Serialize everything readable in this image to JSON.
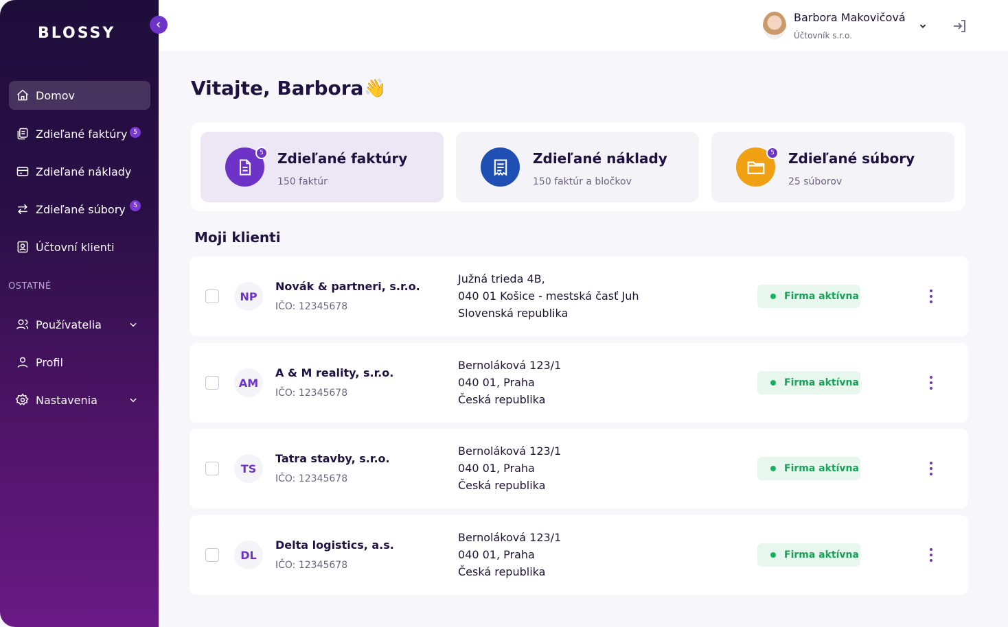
{
  "app": {
    "logo": "BLOSSY"
  },
  "sidebar": {
    "items": [
      {
        "label": "Domov",
        "icon": "home-icon",
        "active": true
      },
      {
        "label": "Zdieľané faktúry",
        "icon": "documents-icon",
        "badge": "5"
      },
      {
        "label": "Zdieľané náklady",
        "icon": "card-icon"
      },
      {
        "label": "Zdieľané súbory",
        "icon": "arrows-icon",
        "badge": "5"
      },
      {
        "label": "Účtovní klienti",
        "icon": "contact-icon"
      }
    ],
    "section_label": "OSTATNÉ",
    "other_items": [
      {
        "label": "Používatelia",
        "icon": "users-icon",
        "expandable": true
      },
      {
        "label": "Profil",
        "icon": "person-icon"
      },
      {
        "label": "Nastavenia",
        "icon": "gear-icon",
        "expandable": true
      }
    ]
  },
  "user": {
    "name": "Barbora Makovičová",
    "role": "Účtovník s.r.o."
  },
  "main": {
    "title": "Vitajte, Barbora",
    "cards": [
      {
        "title": "Zdieľané faktúry",
        "subtitle": "150 faktúr",
        "badge": "5",
        "color": "#6d32c8"
      },
      {
        "title": "Zdieľané náklady",
        "subtitle": "150 faktúr a bločkov",
        "color": "#1f4fb3"
      },
      {
        "title": "Zdieľané súbory",
        "subtitle": "25 súborov",
        "badge": "5",
        "color": "#f0a013"
      }
    ],
    "clients_title": "Moji klienti",
    "clients": [
      {
        "initials": "NP",
        "name": "Novák & partneri, s.r.o.",
        "ico": "IČO: 12345678",
        "address": [
          "Južná trieda 4B,",
          "040 01 Košice - mestská časť Juh",
          "Slovenská republika"
        ],
        "status": "Firma aktívna"
      },
      {
        "initials": "AM",
        "name": "A & M reality, s.r.o.",
        "ico": "IČO: 12345678",
        "address": [
          "Bernoláková 123/1",
          "040 01,  Praha",
          "Česká republika"
        ],
        "status": "Firma aktívna"
      },
      {
        "initials": "TS",
        "name": "Tatra stavby, s.r.o.",
        "ico": "IČO: 12345678",
        "address": [
          "Bernoláková 123/1",
          "040 01,  Praha",
          "Česká republika"
        ],
        "status": "Firma aktívna"
      },
      {
        "initials": "DL",
        "name": "Delta logistics, a.s.",
        "ico": "IČO: 12345678",
        "address": [
          "Bernoláková 123/1",
          "040 01,  Praha",
          "Česká republika"
        ],
        "status": "Firma aktívna"
      }
    ]
  },
  "colors": {
    "accent": "#6d32c8",
    "status_green": "#17a257"
  }
}
